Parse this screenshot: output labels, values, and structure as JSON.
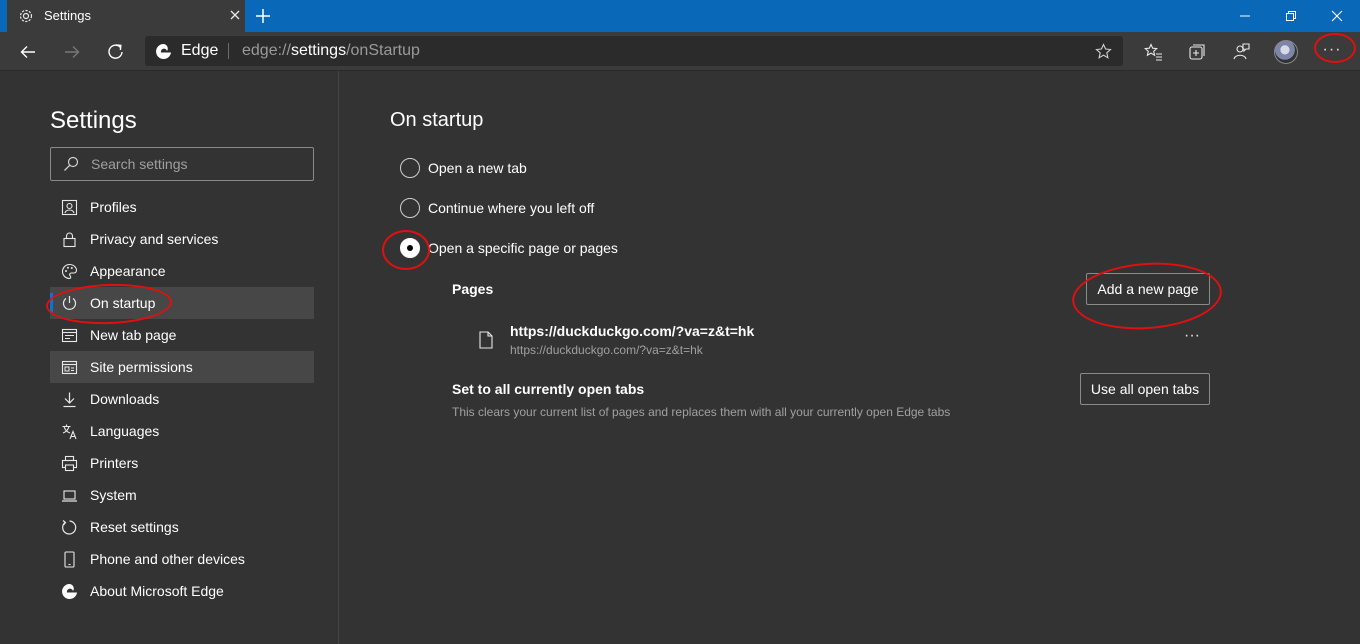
{
  "window": {
    "tab_title": "Settings",
    "tab_icon": "gear-icon",
    "controls": [
      "minimize",
      "restore",
      "close"
    ]
  },
  "address_bar": {
    "brand": "Edge",
    "url_scheme": "edge://",
    "url_host": "settings",
    "url_path": "/onStartup"
  },
  "sidebar": {
    "title": "Settings",
    "search_placeholder": "Search settings",
    "items": [
      {
        "label": "Profiles",
        "icon": "profile-icon"
      },
      {
        "label": "Privacy and services",
        "icon": "lock-icon"
      },
      {
        "label": "Appearance",
        "icon": "palette-icon"
      },
      {
        "label": "On startup",
        "icon": "power-icon",
        "active": true
      },
      {
        "label": "New tab page",
        "icon": "newtab-icon"
      },
      {
        "label": "Site permissions",
        "icon": "site-permissions-icon",
        "hover": true
      },
      {
        "label": "Downloads",
        "icon": "download-icon"
      },
      {
        "label": "Languages",
        "icon": "languages-icon"
      },
      {
        "label": "Printers",
        "icon": "printer-icon"
      },
      {
        "label": "System",
        "icon": "laptop-icon"
      },
      {
        "label": "Reset settings",
        "icon": "reset-icon"
      },
      {
        "label": "Phone and other devices",
        "icon": "phone-icon"
      },
      {
        "label": "About Microsoft Edge",
        "icon": "edge-logo-icon"
      }
    ]
  },
  "main": {
    "heading": "On startup",
    "options": [
      {
        "label": "Open a new tab",
        "checked": false
      },
      {
        "label": "Continue where you left off",
        "checked": false
      },
      {
        "label": "Open a specific page or pages",
        "checked": true
      }
    ],
    "pages_label": "Pages",
    "add_page_button": "Add a new page",
    "page_entry": {
      "title": "https://duckduckgo.com/?va=z&t=hk",
      "url": "https://duckduckgo.com/?va=z&t=hk",
      "more": "···"
    },
    "open_tabs_label": "Set to all currently open tabs",
    "open_tabs_desc": "This clears your current list of pages and replaces them with all your currently open Edge tabs",
    "use_open_tabs_button": "Use all open tabs"
  },
  "toolbar": {
    "more_label": "···"
  },
  "colors": {
    "titlebar": "#0a68b8",
    "background": "#333333",
    "accent": "#0a74da",
    "annotation": "#e01010"
  }
}
